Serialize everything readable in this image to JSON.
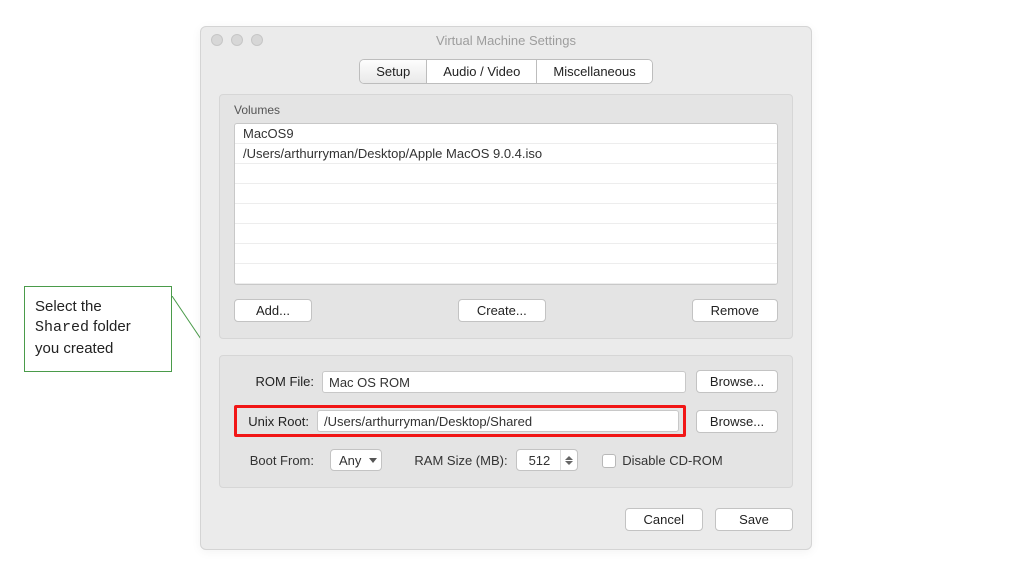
{
  "window": {
    "title": "Virtual Machine Settings"
  },
  "tabs": {
    "setup": "Setup",
    "av": "Audio / Video",
    "misc": "Miscellaneous"
  },
  "volumes": {
    "label": "Volumes",
    "items": [
      "MacOS9",
      "/Users/arthurryman/Desktop/Apple MacOS 9.0.4.iso"
    ],
    "add": "Add...",
    "create": "Create...",
    "remove": "Remove"
  },
  "rom": {
    "label": "ROM File:",
    "value": "Mac OS ROM",
    "browse": "Browse..."
  },
  "unix": {
    "label": "Unix Root:",
    "value": "/Users/arthurryman/Desktop/Shared",
    "browse": "Browse..."
  },
  "boot": {
    "label": "Boot From:",
    "value": "Any"
  },
  "ram": {
    "label": "RAM Size (MB):",
    "value": "512"
  },
  "cdrom": {
    "label": "Disable CD-ROM"
  },
  "footer": {
    "cancel": "Cancel",
    "save": "Save"
  },
  "callout": {
    "line1": "Select the",
    "shared": "Shared",
    "line2_rest": " folder",
    "line3": "you created"
  }
}
